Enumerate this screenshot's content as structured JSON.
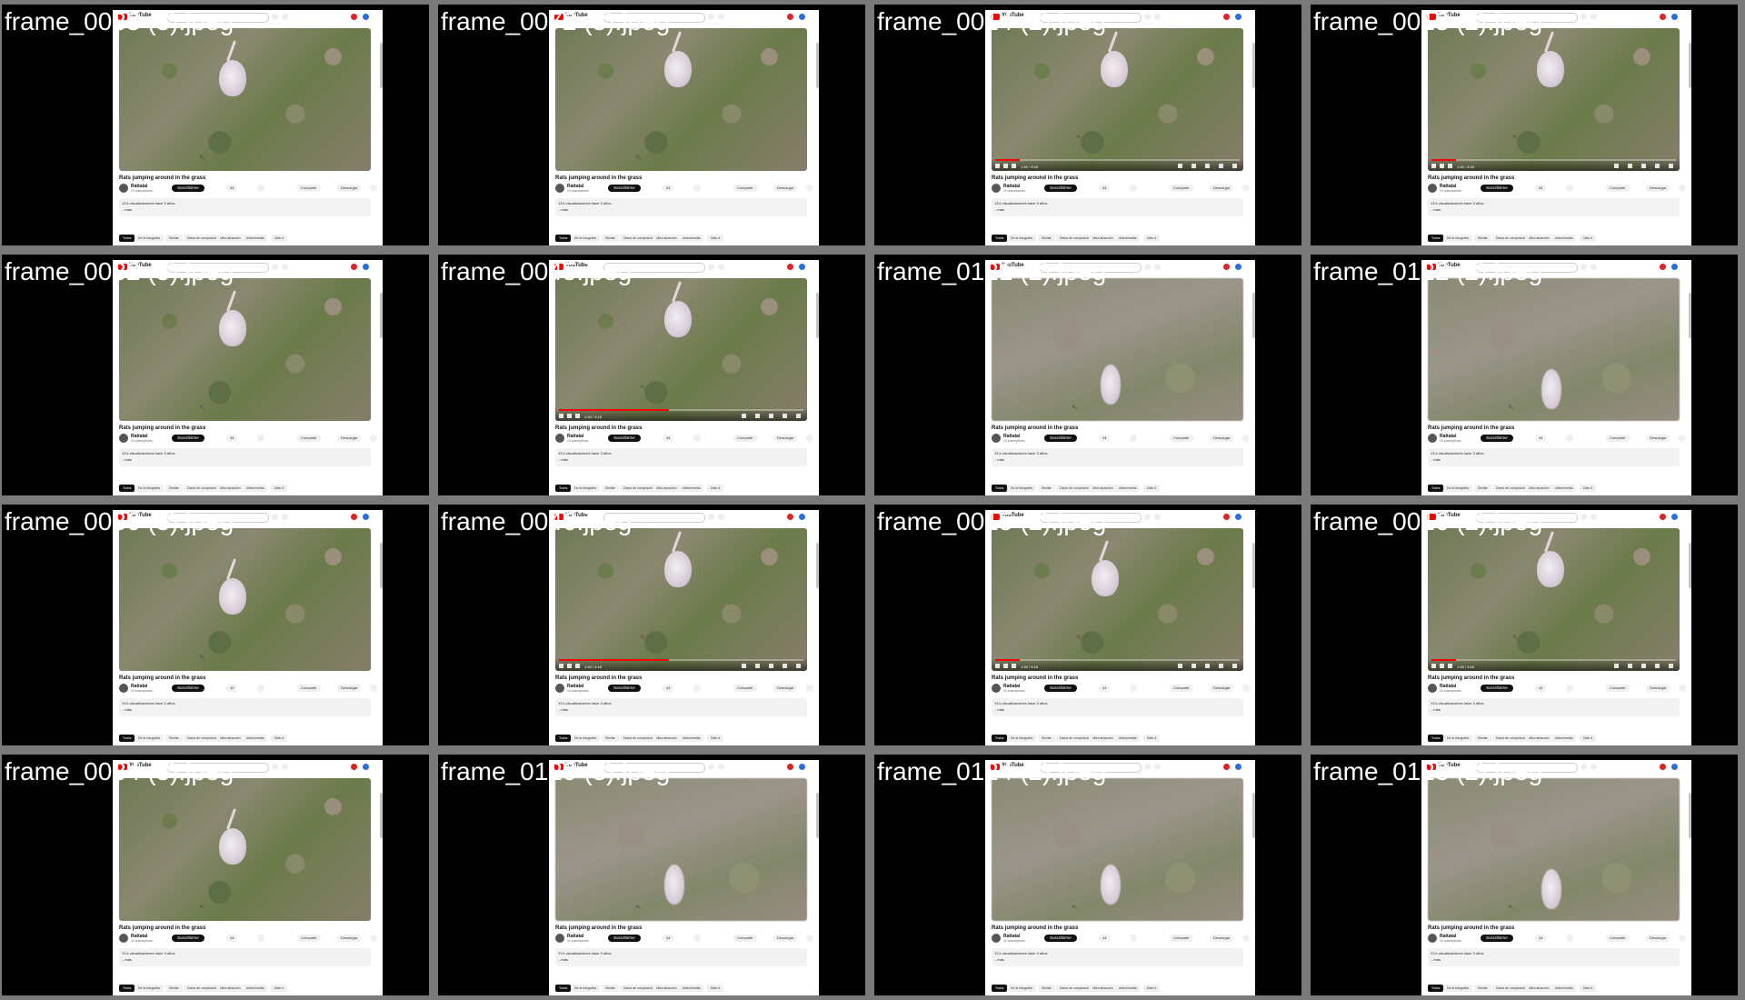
{
  "common": {
    "logo_text": "YouTube",
    "video_title": "Rats jumping around in the grass",
    "channel_name": "Rattatal",
    "subscriber_count": "10 suscriptores",
    "subscribe_label": "Suscribirme",
    "like_count": "44",
    "share_label": "Compartir",
    "download_label": "Descargar",
    "views_line": "13 k visualizaciones hace 3 años",
    "more_label": "...más",
    "chips": [
      "Todos",
      "De la fotografía",
      "Similar",
      "Datos de composición",
      "Ultra atracción",
      "Antes/media",
      "Dato 4"
    ],
    "time_readout": "1:45 / 3:18"
  },
  "frames": [
    {
      "label": "frame_0083 (3).jpeg",
      "scene": "grass",
      "controls": false,
      "rat": "center"
    },
    {
      "label": "frame_0072 (3).jpeg",
      "scene": "grass",
      "controls": false,
      "rat": "center-right"
    },
    {
      "label": "frame_0014 (2).jpeg",
      "scene": "grass",
      "controls": true,
      "rat": "center-right",
      "progress": 0.1
    },
    {
      "label": "frame_0013 (2).jpeg",
      "scene": "grass",
      "controls": true,
      "rat": "center-right",
      "progress": 0.1
    },
    {
      "label": "frame_0082 (3).jpeg",
      "scene": "grass",
      "controls": false,
      "rat": "center"
    },
    {
      "label": "frame_0045.jpeg",
      "scene": "grass",
      "controls": true,
      "rat": "center-right",
      "progress": 0.45
    },
    {
      "label": "frame_0121 (2).jpeg",
      "scene": "blur",
      "controls": false,
      "rat": "bottom"
    },
    {
      "label": "frame_0122 (2).jpeg",
      "scene": "blur",
      "controls": false,
      "rat": "bottom-right"
    },
    {
      "label": "frame_0086 (3).jpeg",
      "scene": "grass",
      "controls": false,
      "rat": "center-low"
    },
    {
      "label": "frame_0046.jpeg",
      "scene": "grass",
      "controls": true,
      "rat": "center-right",
      "progress": 0.45
    },
    {
      "label": "frame_0015 (2).jpeg",
      "scene": "grass",
      "controls": true,
      "rat": "center",
      "progress": 0.1
    },
    {
      "label": "frame_0016 (2).jpeg",
      "scene": "grass",
      "controls": true,
      "rat": "center-right",
      "progress": 0.1
    },
    {
      "label": "frame_0084 (3).jpeg",
      "scene": "grass",
      "controls": false,
      "rat": "center-low"
    },
    {
      "label": "frame_0120 (3).jpeg",
      "scene": "blur",
      "controls": false,
      "rat": "bottom"
    },
    {
      "label": "frame_0124 (2).jpeg",
      "scene": "blur",
      "controls": false,
      "rat": "bottom"
    },
    {
      "label": "frame_0123 (2).jpeg",
      "scene": "blur",
      "controls": false,
      "rat": "bottom-right"
    }
  ]
}
